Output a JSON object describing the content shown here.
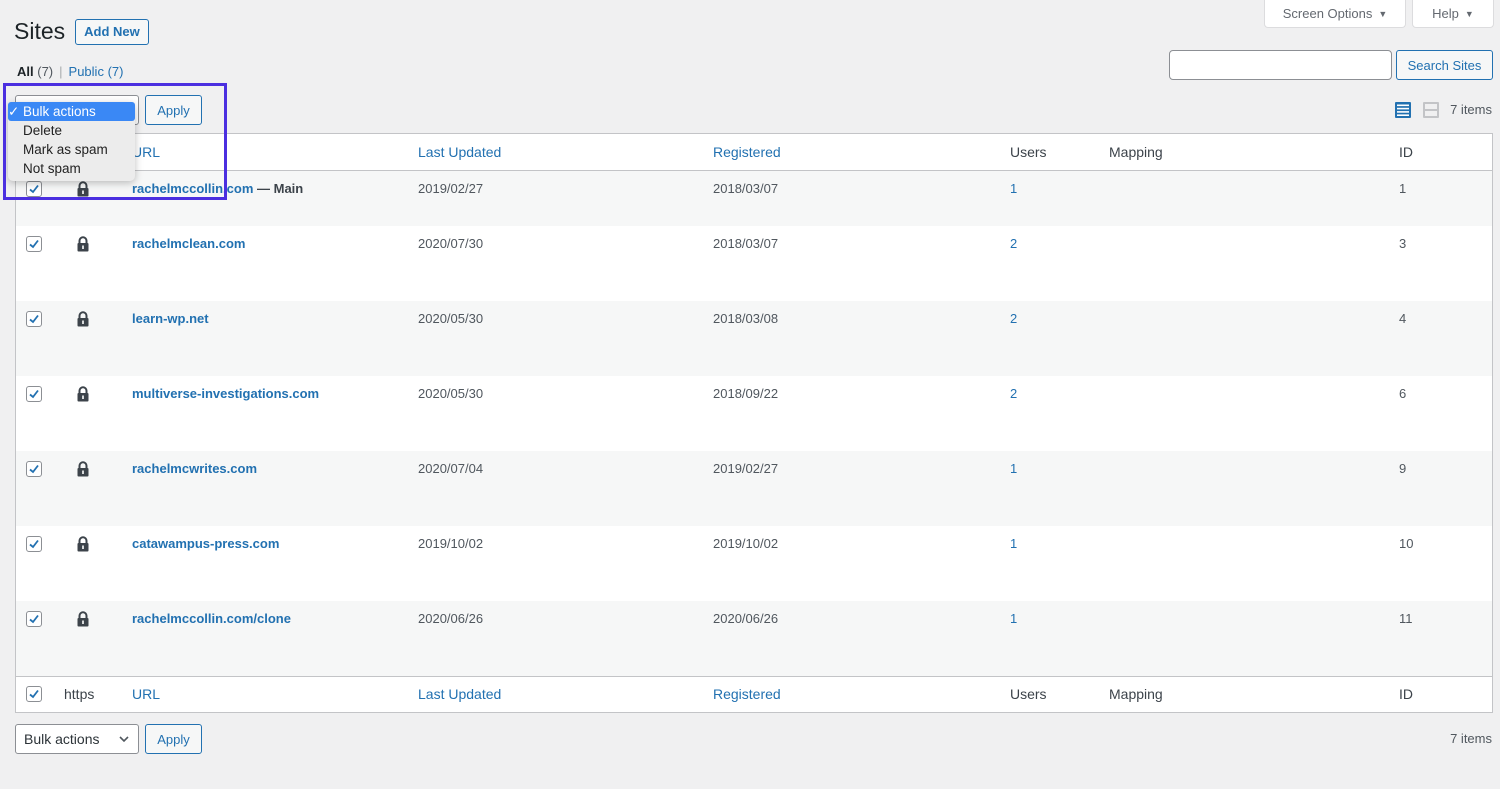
{
  "screen_meta": {
    "screen_options_label": "Screen Options",
    "help_label": "Help",
    "arrow": "▼"
  },
  "header": {
    "title": "Sites",
    "add_new_label": "Add New"
  },
  "filters": {
    "all_label": "All",
    "all_count": "(7)",
    "separator": "|",
    "public_label": "Public",
    "public_count": "(7)"
  },
  "search": {
    "value": "",
    "placeholder": "",
    "button_label": "Search Sites"
  },
  "tablenav_top": {
    "bulk_selected": "Bulk actions",
    "apply_label": "Apply",
    "items_count": "7 items",
    "view_modes": [
      {
        "name": "list-view-icon",
        "active": true
      },
      {
        "name": "excerpt-view-icon",
        "active": false
      }
    ]
  },
  "bulk_dropdown": {
    "open": true,
    "check_glyph": "✓",
    "options": [
      "Bulk actions",
      "Delete",
      "Mark as spam",
      "Not spam"
    ],
    "selected_index": 0
  },
  "table": {
    "columns": {
      "url": "URL",
      "last_updated": "Last Updated",
      "registered": "Registered",
      "users": "Users",
      "mapping": "Mapping",
      "id": "ID"
    },
    "footer_https_label": "https",
    "rows": [
      {
        "checked": true,
        "url": "rachelmccollin.com",
        "suffix": " — Main",
        "last_updated": "2019/02/27",
        "registered": "2018/03/07",
        "users": "1",
        "mapping": "",
        "id": "1"
      },
      {
        "checked": true,
        "url": "rachelmclean.com",
        "suffix": "",
        "last_updated": "2020/07/30",
        "registered": "2018/03/07",
        "users": "2",
        "mapping": "",
        "id": "3"
      },
      {
        "checked": true,
        "url": "learn-wp.net",
        "suffix": "",
        "last_updated": "2020/05/30",
        "registered": "2018/03/08",
        "users": "2",
        "mapping": "",
        "id": "4"
      },
      {
        "checked": true,
        "url": "multiverse-investigations.com",
        "suffix": "",
        "last_updated": "2020/05/30",
        "registered": "2018/09/22",
        "users": "2",
        "mapping": "",
        "id": "6"
      },
      {
        "checked": true,
        "url": "rachelmcwrites.com",
        "suffix": "",
        "last_updated": "2020/07/04",
        "registered": "2019/02/27",
        "users": "1",
        "mapping": "",
        "id": "9"
      },
      {
        "checked": true,
        "url": "catawampus-press.com",
        "suffix": "",
        "last_updated": "2019/10/02",
        "registered": "2019/10/02",
        "users": "1",
        "mapping": "",
        "id": "10"
      },
      {
        "checked": true,
        "url": "rachelmccollin.com/clone",
        "suffix": "",
        "last_updated": "2020/06/26",
        "registered": "2020/06/26",
        "users": "1",
        "mapping": "",
        "id": "11"
      }
    ]
  },
  "tablenav_bottom": {
    "bulk_selected": "Bulk actions",
    "apply_label": "Apply",
    "items_count": "7 items"
  },
  "colors": {
    "link": "#2271b1",
    "highlight_box": "#4b2fe0",
    "dropdown_selected": "#3a88f5"
  }
}
